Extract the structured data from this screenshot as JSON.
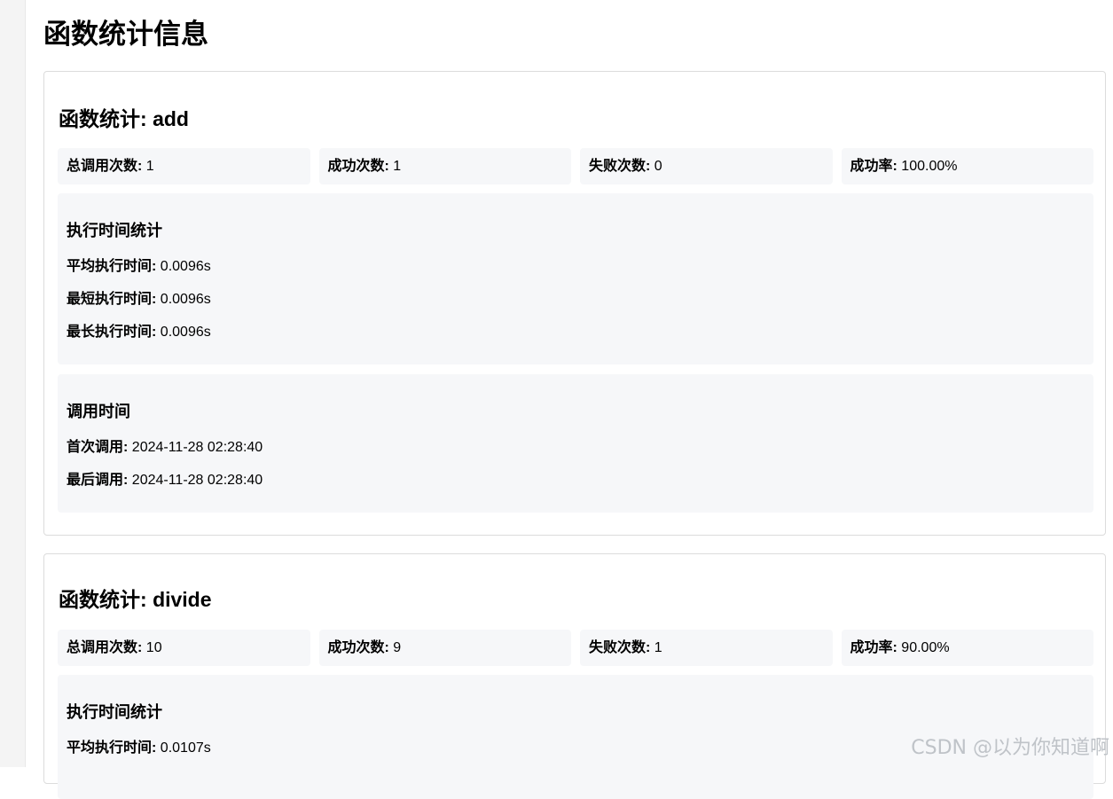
{
  "page": {
    "title": "函数统计信息"
  },
  "functions": [
    {
      "title_prefix": "函数统计: ",
      "name": "add",
      "stats": {
        "total_label": "总调用次数:",
        "total_value": "1",
        "success_label": "成功次数:",
        "success_value": "1",
        "fail_label": "失败次数:",
        "fail_value": "0",
        "rate_label": "成功率:",
        "rate_value": "100.00%"
      },
      "exec_time": {
        "title": "执行时间统计",
        "avg_label": "平均执行时间:",
        "avg_value": "0.0096s",
        "min_label": "最短执行时间:",
        "min_value": "0.0096s",
        "max_label": "最长执行时间:",
        "max_value": "0.0096s"
      },
      "call_time": {
        "title": "调用时间",
        "first_label": "首次调用:",
        "first_value": "2024-11-28 02:28:40",
        "last_label": "最后调用:",
        "last_value": "2024-11-28 02:28:40"
      }
    },
    {
      "title_prefix": "函数统计: ",
      "name": "divide",
      "stats": {
        "total_label": "总调用次数:",
        "total_value": "10",
        "success_label": "成功次数:",
        "success_value": "9",
        "fail_label": "失败次数:",
        "fail_value": "1",
        "rate_label": "成功率:",
        "rate_value": "90.00%"
      },
      "exec_time": {
        "title": "执行时间统计",
        "avg_label": "平均执行时间:",
        "avg_value": "0.0107s"
      }
    }
  ],
  "watermark": "CSDN @以为你知道啊"
}
